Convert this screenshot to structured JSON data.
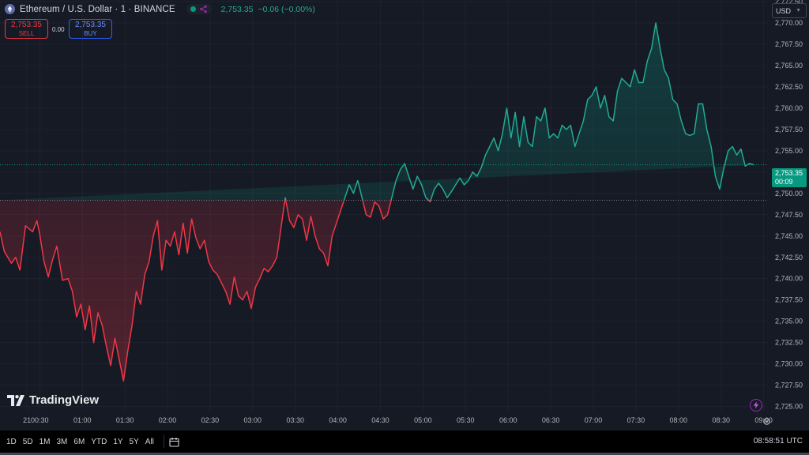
{
  "header": {
    "symbol_line": "Ethereum / U.S. Dollar · 1 · BINANCE",
    "last_price": "2,753.35",
    "change": "−0.06 (−0.00%)"
  },
  "trade": {
    "sell_price": "2,753.35",
    "sell_label": "SELL",
    "spread": "0.00",
    "buy_price": "2,753.35",
    "buy_label": "BUY"
  },
  "currency": "USD",
  "price_tag": {
    "price": "2,753.35",
    "countdown": "00:09"
  },
  "logo_text": "TradingView",
  "bottom_bar": {
    "ranges": [
      "1D",
      "5D",
      "1M",
      "3M",
      "6M",
      "YTD",
      "1Y",
      "5Y",
      "All"
    ],
    "clock": "08:58:51 UTC"
  },
  "icons": {
    "symbol": "ethereum-icon",
    "share": "share-icon",
    "calendar": "calendar-icon",
    "flash": "flash-icon",
    "settings": "gear-icon"
  },
  "colors": {
    "background": "#161a25",
    "up": "#22ab94",
    "down": "#f23645",
    "price_tag": "#089981",
    "grid": "#1f2330",
    "axis_text": "#b2b5be"
  },
  "chart_data": {
    "type": "area",
    "baseline_style": true,
    "xlim": [
      "00:02",
      "09:03"
    ],
    "ylim": [
      2724.5,
      2772.5
    ],
    "baseline": 2749.2,
    "last_value": 2753.35,
    "y_ticks": [
      2725,
      2727.5,
      2730,
      2732.5,
      2735,
      2737.5,
      2740,
      2742.5,
      2745,
      2747.5,
      2750,
      2752.5,
      2755,
      2757.5,
      2760,
      2762.5,
      2765,
      2767.5,
      2770,
      2772.5
    ],
    "y_tick_labels": [
      "2,725.00",
      "2,727.50",
      "2,730.00",
      "2,732.50",
      "2,735.00",
      "2,737.50",
      "2,740.00",
      "2,742.50",
      "2,745.00",
      "2,747.50",
      "2,750.00",
      "2,752.50",
      "2,755.00",
      "2,757.50",
      "2,760.00",
      "2,762.50",
      "2,765.00",
      "2,767.50",
      "2,770.00",
      "2,772.50"
    ],
    "x_ticks": [
      "00:21",
      "00:30",
      "01:00",
      "01:30",
      "02:00",
      "02:30",
      "03:00",
      "03:30",
      "04:00",
      "04:30",
      "05:00",
      "05:30",
      "06:00",
      "06:30",
      "07:00",
      "07:30",
      "08:00",
      "08:30",
      "09:00"
    ],
    "x_tick_labels": [
      "21",
      "00:30",
      "01:00",
      "01:30",
      "02:00",
      "02:30",
      "03:00",
      "03:30",
      "04:00",
      "04:30",
      "05:00",
      "05:30",
      "06:00",
      "06:30",
      "07:00",
      "07:30",
      "08:00",
      "08:30",
      "09:00"
    ],
    "x": [
      "00:02",
      "00:05",
      "00:10",
      "00:13",
      "00:16",
      "00:20",
      "00:25",
      "00:28",
      "00:30",
      "00:33",
      "00:36",
      "00:39",
      "00:42",
      "00:46",
      "00:50",
      "00:53",
      "00:56",
      "00:59",
      "01:02",
      "01:05",
      "01:08",
      "01:11",
      "01:14",
      "01:17",
      "01:20",
      "01:23",
      "01:26",
      "01:29",
      "01:32",
      "01:35",
      "01:38",
      "01:41",
      "01:44",
      "01:47",
      "01:50",
      "01:53",
      "01:56",
      "01:59",
      "02:02",
      "02:05",
      "02:08",
      "02:11",
      "02:14",
      "02:17",
      "02:20",
      "02:23",
      "02:26",
      "02:29",
      "02:32",
      "02:35",
      "02:38",
      "02:41",
      "02:44",
      "02:47",
      "02:50",
      "02:53",
      "02:56",
      "02:59",
      "03:02",
      "03:05",
      "03:08",
      "03:11",
      "03:14",
      "03:17",
      "03:20",
      "03:23",
      "03:26",
      "03:29",
      "03:32",
      "03:35",
      "03:38",
      "03:41",
      "03:44",
      "03:47",
      "03:50",
      "03:53",
      "03:56",
      "03:59",
      "04:02",
      "04:05",
      "04:08",
      "04:11",
      "04:14",
      "04:17",
      "04:20",
      "04:23",
      "04:26",
      "04:29",
      "04:32",
      "04:35",
      "04:38",
      "04:41",
      "04:44",
      "04:47",
      "04:50",
      "04:53",
      "04:56",
      "04:59",
      "05:02",
      "05:05",
      "05:08",
      "05:11",
      "05:14",
      "05:17",
      "05:20",
      "05:23",
      "05:26",
      "05:29",
      "05:32",
      "05:35",
      "05:38",
      "05:41",
      "05:44",
      "05:47",
      "05:50",
      "05:53",
      "05:56",
      "05:59",
      "06:02",
      "06:05",
      "06:08",
      "06:11",
      "06:14",
      "06:17",
      "06:20",
      "06:23",
      "06:26",
      "06:29",
      "06:32",
      "06:35",
      "06:38",
      "06:41",
      "06:44",
      "06:47",
      "06:50",
      "06:53",
      "06:56",
      "06:59",
      "07:02",
      "07:05",
      "07:08",
      "07:11",
      "07:14",
      "07:17",
      "07:20",
      "07:23",
      "07:26",
      "07:29",
      "07:32",
      "07:35",
      "07:38",
      "07:41",
      "07:44",
      "07:47",
      "07:50",
      "07:53",
      "07:56",
      "07:59",
      "08:02",
      "08:05",
      "08:08",
      "08:11",
      "08:14",
      "08:17",
      "08:20",
      "08:23",
      "08:26",
      "08:29",
      "08:32",
      "08:35",
      "08:38",
      "08:41",
      "08:44",
      "08:47",
      "08:50",
      "08:53",
      "08:56",
      "08:58"
    ],
    "y": [
      2745.5,
      2743.2,
      2741.8,
      2742.5,
      2741.0,
      2746.2,
      2745.5,
      2746.8,
      2745.2,
      2742.0,
      2740.2,
      2742.2,
      2743.8,
      2739.8,
      2740.0,
      2738.5,
      2735.5,
      2737.0,
      2734.0,
      2736.8,
      2732.5,
      2736.0,
      2734.5,
      2732.0,
      2729.8,
      2733.0,
      2730.5,
      2728.0,
      2731.5,
      2734.5,
      2738.5,
      2737.0,
      2740.5,
      2742.0,
      2745.0,
      2746.8,
      2741.0,
      2744.5,
      2743.8,
      2745.5,
      2742.8,
      2746.5,
      2743.0,
      2747.0,
      2744.8,
      2743.5,
      2744.5,
      2742.0,
      2741.0,
      2740.5,
      2739.5,
      2738.5,
      2737.0,
      2740.2,
      2738.0,
      2737.5,
      2738.5,
      2736.5,
      2739.0,
      2740.0,
      2741.2,
      2740.8,
      2741.5,
      2742.5,
      2746.0,
      2749.5,
      2746.8,
      2746.0,
      2747.5,
      2747.0,
      2744.5,
      2747.3,
      2745.0,
      2743.5,
      2743.0,
      2741.5,
      2745.0,
      2746.5,
      2748.0,
      2749.5,
      2751.0,
      2750.0,
      2751.5,
      2749.5,
      2747.5,
      2747.2,
      2749.0,
      2748.5,
      2747.0,
      2747.5,
      2749.5,
      2751.5,
      2752.8,
      2753.5,
      2752.0,
      2750.5,
      2752.0,
      2751.0,
      2749.5,
      2749.0,
      2750.5,
      2751.2,
      2750.5,
      2749.5,
      2750.2,
      2751.0,
      2751.8,
      2751.0,
      2751.5,
      2752.5,
      2752.0,
      2753.0,
      2754.5,
      2755.5,
      2756.5,
      2755.0,
      2757.0,
      2760.0,
      2756.5,
      2759.5,
      2755.5,
      2759.0,
      2756.0,
      2755.5,
      2759.0,
      2758.5,
      2760.0,
      2756.5,
      2757.0,
      2756.5,
      2758.0,
      2757.5,
      2758.0,
      2755.5,
      2757.0,
      2758.5,
      2761.0,
      2761.5,
      2762.5,
      2760.0,
      2761.5,
      2759.0,
      2758.5,
      2762.0,
      2763.5,
      2763.0,
      2762.5,
      2764.5,
      2763.0,
      2763.0,
      2765.5,
      2767.0,
      2770.0,
      2767.0,
      2764.5,
      2763.5,
      2761.0,
      2760.5,
      2758.5,
      2757.0,
      2756.8,
      2757.0,
      2760.5,
      2760.5,
      2757.5,
      2755.5,
      2752.0,
      2750.5,
      2753.0,
      2755.0,
      2755.5,
      2754.5,
      2755.2,
      2753.2,
      2753.5,
      2753.35
    ]
  }
}
